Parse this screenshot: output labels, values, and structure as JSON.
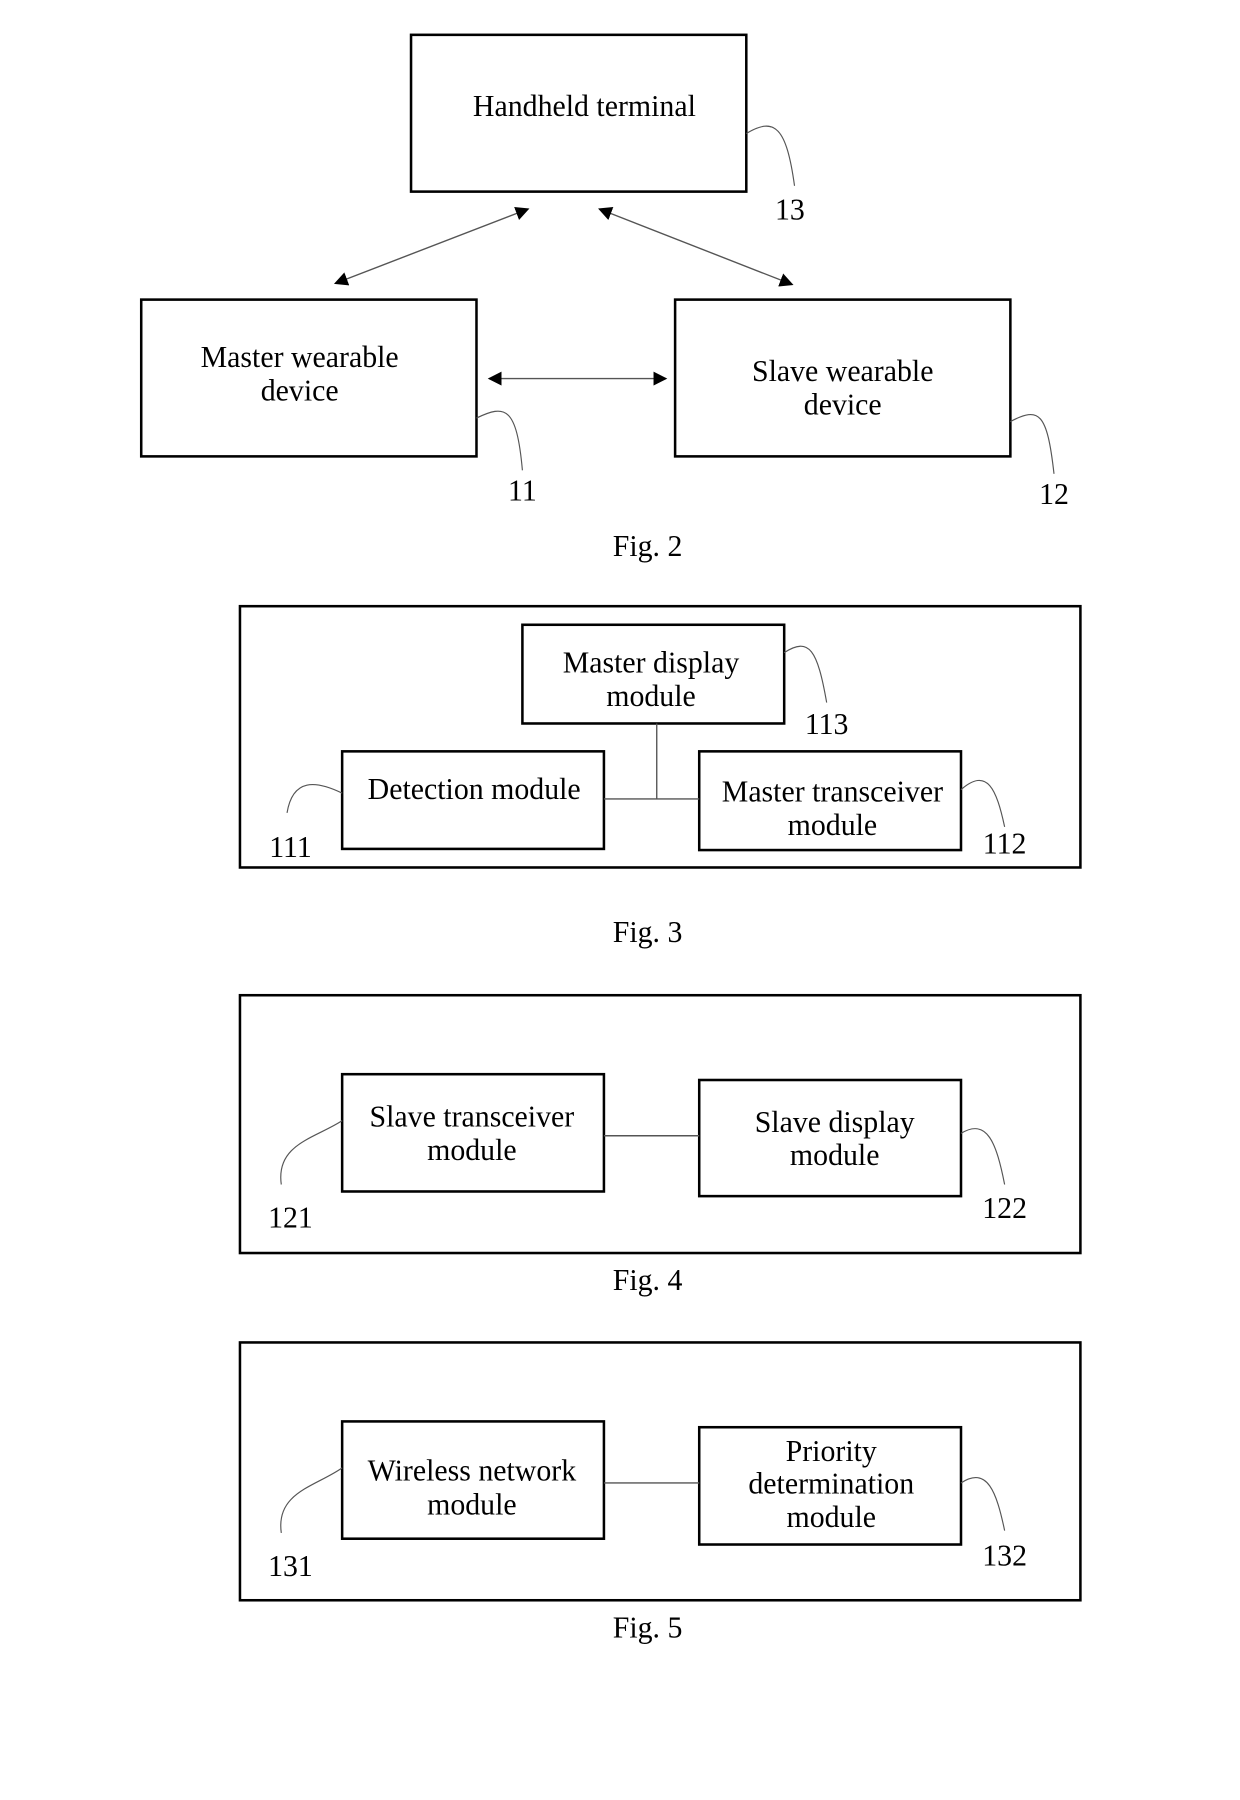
{
  "figures": {
    "fig2": {
      "caption": "Fig. 2",
      "handheld": {
        "line1": "Handheld terminal",
        "ref": "13"
      },
      "master": {
        "line1": "Master wearable",
        "line2": "device",
        "ref": "11"
      },
      "slave": {
        "line1": "Slave wearable",
        "line2": "device",
        "ref": "12"
      }
    },
    "fig3": {
      "caption": "Fig. 3",
      "display": {
        "line1": "Master display",
        "line2": "module",
        "ref": "113"
      },
      "detection": {
        "line1": "Detection module",
        "ref": "111"
      },
      "transceiver": {
        "line1": "Master transceiver",
        "line2": "module",
        "ref": "112"
      }
    },
    "fig4": {
      "caption": "Fig. 4",
      "transceiver": {
        "line1": "Slave transceiver",
        "line2": "module",
        "ref": "121"
      },
      "display": {
        "line1": "Slave display",
        "line2": "module",
        "ref": "122"
      }
    },
    "fig5": {
      "caption": "Fig. 5",
      "wireless": {
        "line1": "Wireless network",
        "line2": "module",
        "ref": "131"
      },
      "priority": {
        "line1": "Priority",
        "line2": "determination",
        "line3": "module",
        "ref": "132"
      }
    }
  }
}
